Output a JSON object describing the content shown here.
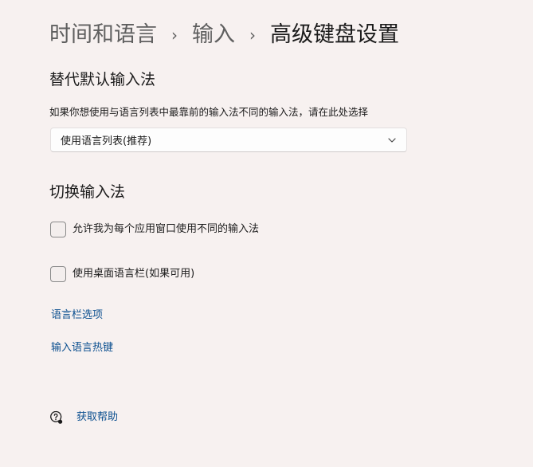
{
  "breadcrumb": {
    "parent": "时间和语言",
    "middle": "输入",
    "current": "高级键盘设置",
    "separator": "›"
  },
  "override_section": {
    "title": "替代默认输入法",
    "description": "如果你想使用与语言列表中最靠前的输入法不同的输入法，请在此处选择",
    "dropdown_value": "使用语言列表(推荐)"
  },
  "switch_section": {
    "title": "切换输入法",
    "checkbox_per_app": {
      "label": "允许我为每个应用窗口使用不同的输入法",
      "checked": false
    },
    "checkbox_language_bar": {
      "label": "使用桌面语言栏(如果可用)",
      "checked": false
    }
  },
  "links": {
    "language_bar_options": "语言栏选项",
    "input_language_hotkeys": "输入语言热键"
  },
  "help": {
    "label": "获取帮助",
    "icon": "help-chat-icon"
  },
  "colors": {
    "background": "#f7f1f0",
    "link": "#0b4f8f",
    "text": "#1b1b1b",
    "muted": "#5f5f5f"
  }
}
